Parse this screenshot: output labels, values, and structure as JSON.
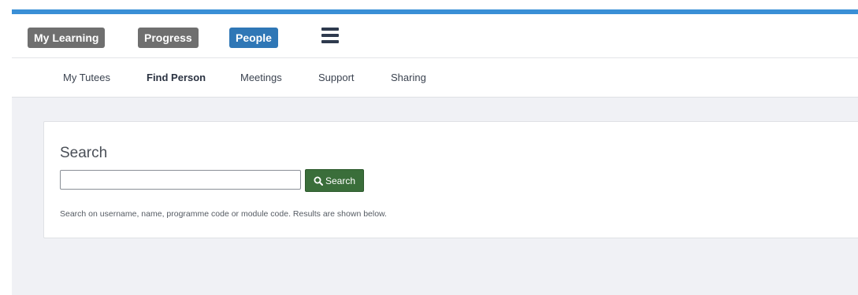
{
  "colors": {
    "top_strip": "#3a8fd6",
    "pill_grey": "#6f6f6f",
    "pill_active": "#2f77b6",
    "search_button": "#3a6e3a",
    "content_background": "#f0f1f5"
  },
  "main_nav": {
    "items": [
      {
        "label": "My Learning",
        "active": false
      },
      {
        "label": "Progress",
        "active": false
      },
      {
        "label": "People",
        "active": true
      }
    ],
    "menu_icon": "hamburger-icon"
  },
  "sub_nav": {
    "items": [
      {
        "label": "My Tutees",
        "active": false
      },
      {
        "label": "Find Person",
        "active": true
      },
      {
        "label": "Meetings",
        "active": false
      },
      {
        "label": "Support",
        "active": false
      },
      {
        "label": "Sharing",
        "active": false
      }
    ]
  },
  "search_card": {
    "title": "Search",
    "input_value": "",
    "button_label": "Search",
    "button_icon": "search-icon",
    "help_text": "Search on username, name, programme code or module code. Results are shown below."
  }
}
